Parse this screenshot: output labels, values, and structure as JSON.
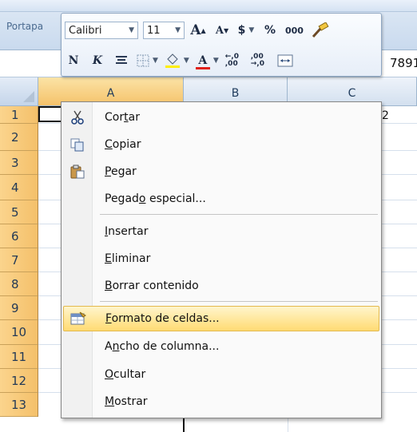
{
  "ribbon": {
    "group_label": "Portapa",
    "cell_value_right": "7891"
  },
  "mini_toolbar": {
    "font_name": "Calibri",
    "font_size": "11",
    "grow_font": "A",
    "shrink_font": "A",
    "currency": "$",
    "percent": "%",
    "thousands": "000",
    "bold": "N",
    "italic": "K",
    "font_color_letter": "A",
    "increase_decimal": "←,0 ,00",
    "decrease_decimal": ",00 →,0"
  },
  "grid": {
    "columns": [
      "A",
      "B",
      "C"
    ],
    "rows": [
      "1",
      "2",
      "3",
      "4",
      "5",
      "6",
      "7",
      "8",
      "9",
      "10",
      "11",
      "12",
      "13"
    ],
    "c1_partial": "2"
  },
  "context_menu": {
    "items": [
      {
        "pre": "Cor",
        "u": "t",
        "post": "ar",
        "icon": "scissors-icon"
      },
      {
        "pre": "",
        "u": "C",
        "post": "opiar",
        "icon": "copy-icon"
      },
      {
        "pre": "",
        "u": "P",
        "post": "egar",
        "icon": "paste-icon"
      },
      {
        "pre": "Pegad",
        "u": "o",
        "post": " especial...",
        "icon": ""
      },
      {
        "pre": "",
        "u": "I",
        "post": "nsertar",
        "icon": ""
      },
      {
        "pre": "",
        "u": "E",
        "post": "liminar",
        "icon": ""
      },
      {
        "pre": "",
        "u": "B",
        "post": "orrar contenido",
        "icon": ""
      },
      {
        "pre": "",
        "u": "F",
        "post": "ormato de celdas...",
        "icon": "format-cells-icon"
      },
      {
        "pre": "A",
        "u": "n",
        "post": "cho de columna...",
        "icon": ""
      },
      {
        "pre": "",
        "u": "O",
        "post": "cultar",
        "icon": ""
      },
      {
        "pre": "",
        "u": "M",
        "post": "ostrar",
        "icon": ""
      }
    ]
  },
  "colors": {
    "menu_highlight": "#ffdb73",
    "row_header": "#f4c06a",
    "ribbon": "#c9daee"
  }
}
